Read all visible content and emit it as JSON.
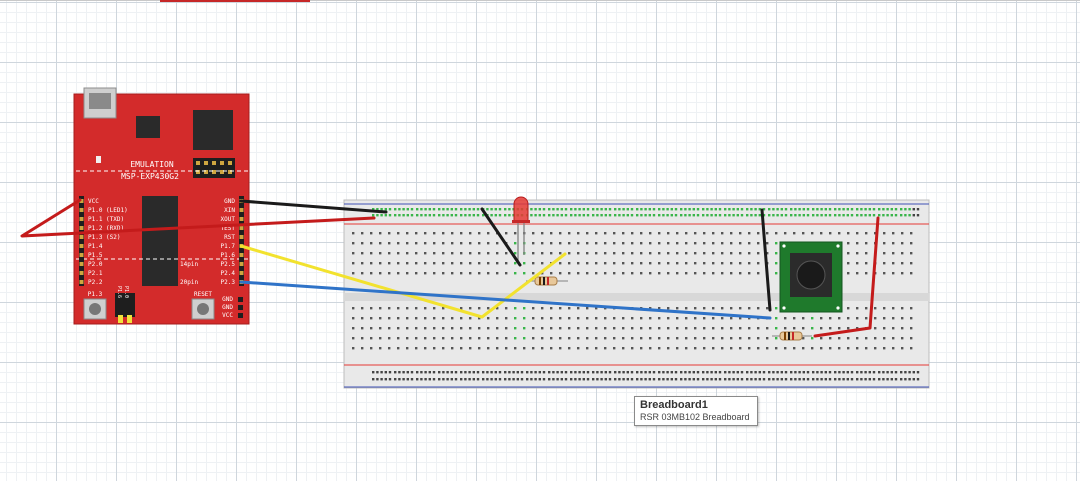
{
  "colors": {
    "board_red": "#d32b2b",
    "breadboard": "#e9e9e9",
    "rail_red": "#e53935",
    "rail_blue": "#3f51b5",
    "hole_green": "#39b54a",
    "wire_black": "#1a1a1a",
    "wire_red": "#c41b1b",
    "wire_yellow": "#f2e22e",
    "wire_blue": "#2f73c8",
    "pcb_green": "#1f7a2c"
  },
  "launchpad": {
    "emulation_label": "EMULATION",
    "model_label": "MSP-EXP430G2",
    "left_pins": [
      "VCC",
      "P1.0 (LED1)",
      "P1.1 (TXD)",
      "P1.2 (RXD)",
      "P1.3 (S2)",
      "P1.4",
      "P1.5",
      "P2.0",
      "P2.1",
      "P2.2"
    ],
    "right_pins": [
      "GND",
      "XIN",
      "XOUT",
      "TEST",
      "RST",
      "P1.7",
      "P1.6",
      "P2.5",
      "P2.4",
      "P2.3"
    ],
    "pin14_label": "14pin",
    "pin20_label": "20pin",
    "button_p13_label": "P1.3",
    "button_reset_label": "RESET",
    "jumper_labels": [
      "P1.6",
      "P1.0"
    ],
    "bottom_pins": [
      "GND",
      "GND",
      "VCC"
    ]
  },
  "components": {
    "led": "led-red",
    "resistor": "resistor",
    "pushbutton": "pushbutton"
  },
  "tooltip": {
    "title": "Breadboard1",
    "subtitle": "RSR 03MB102 Breadboard"
  }
}
